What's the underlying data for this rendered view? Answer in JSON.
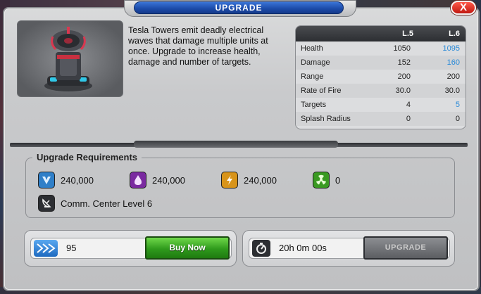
{
  "dialog": {
    "title": "UPGRADE",
    "close_label": "X"
  },
  "building": {
    "description": "Tesla Towers emit deadly electrical waves that damage multiple units at once. Upgrade to increase health, damage and number of targets."
  },
  "stats": {
    "col_current": "L.5",
    "col_next": "L.6",
    "rows": [
      {
        "name": "Health",
        "current": "1050",
        "next": "1095",
        "improved": true
      },
      {
        "name": "Damage",
        "current": "152",
        "next": "160",
        "improved": true
      },
      {
        "name": "Range",
        "current": "200",
        "next": "200",
        "improved": false
      },
      {
        "name": "Rate of Fire",
        "current": "30.0",
        "next": "30.0",
        "improved": false
      },
      {
        "name": "Targets",
        "current": "4",
        "next": "5",
        "improved": true
      },
      {
        "name": "Splash Radius",
        "current": "0",
        "next": "0",
        "improved": false
      }
    ]
  },
  "requirements": {
    "title": "Upgrade Requirements",
    "resources": [
      {
        "icon": "metal-icon",
        "amount": "240,000",
        "color": "#2f7fc8"
      },
      {
        "icon": "oil-icon",
        "amount": "240,000",
        "color": "#7a2aa0"
      },
      {
        "icon": "energy-icon",
        "amount": "240,000",
        "color": "#d8941a"
      },
      {
        "icon": "uranium-icon",
        "amount": "0",
        "color": "#3a9a22"
      }
    ],
    "building_req": "Comm. Center Level 6"
  },
  "buy": {
    "gold_amount": "95",
    "button_label": "Buy Now"
  },
  "timer": {
    "duration": "20h 0m 00s",
    "button_label": "UPGRADE"
  },
  "colors": {
    "improved_stat": "#2a8ad8",
    "title_blue": "#1b4aa8",
    "buy_green": "#2f9a1c"
  }
}
